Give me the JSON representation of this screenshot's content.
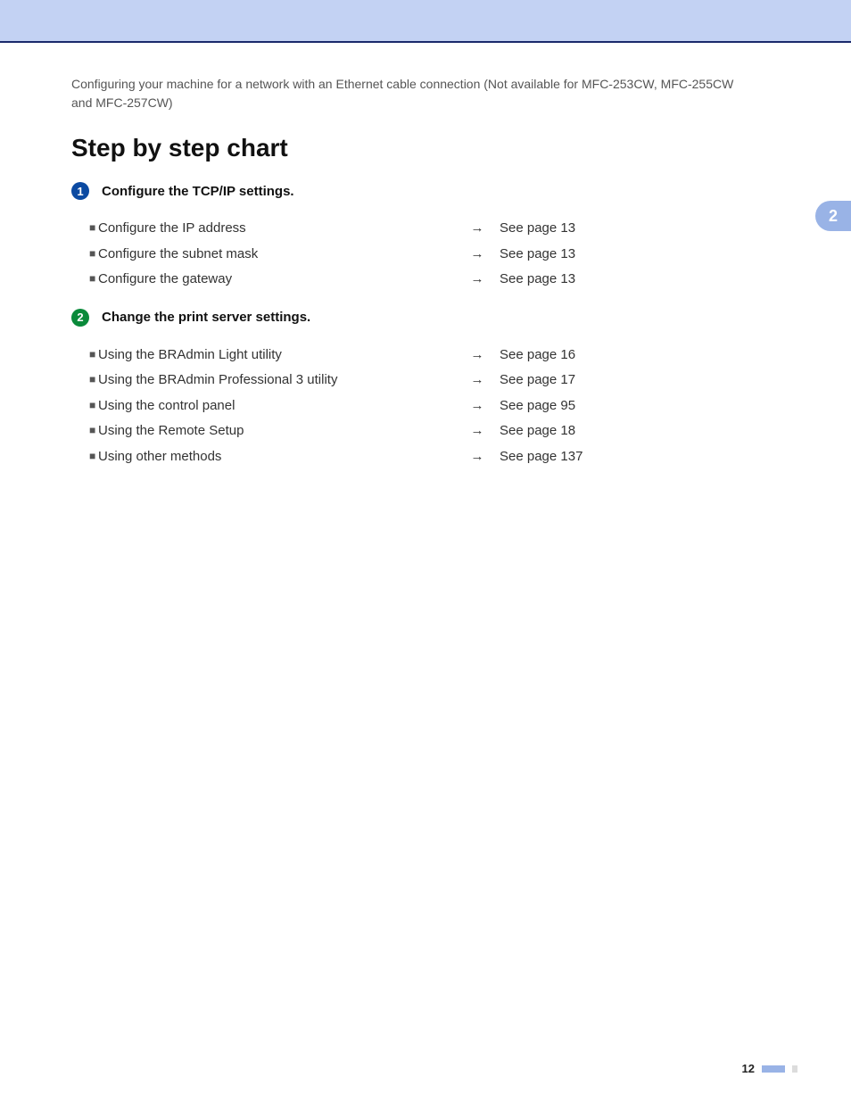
{
  "header": {
    "breadcrumb": "Configuring your machine for a network with an Ethernet cable connection (Not available for MFC-253CW, MFC-255CW and MFC-257CW)"
  },
  "title": "Step by step chart",
  "sideTab": "2",
  "steps": [
    {
      "badgeColor": "#0b4aa2",
      "number": "1",
      "title": "Configure the TCP/IP settings.",
      "rows": [
        {
          "label": "Configure the IP address",
          "ref": "See page 13"
        },
        {
          "label": "Configure the subnet mask",
          "ref": "See page 13"
        },
        {
          "label": "Configure the gateway",
          "ref": "See page 13"
        }
      ]
    },
    {
      "badgeColor": "#0a8a3a",
      "number": "2",
      "title": "Change the print server settings.",
      "rows": [
        {
          "label": "Using the BRAdmin Light utility",
          "ref": "See page 16"
        },
        {
          "label": "Using the BRAdmin Professional 3 utility",
          "ref": "See page 17"
        },
        {
          "label": "Using the control panel",
          "ref": "See page 95"
        },
        {
          "label": "Using the Remote Setup",
          "ref": "See page 18"
        },
        {
          "label": "Using other methods",
          "ref": "See page 137"
        }
      ]
    }
  ],
  "arrowGlyph": "→",
  "bulletGlyph": "■",
  "pageNumber": "12"
}
